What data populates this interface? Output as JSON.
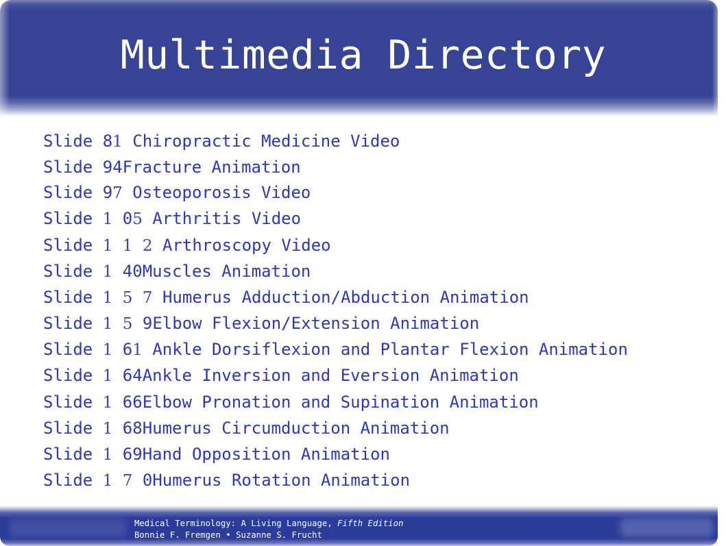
{
  "header": {
    "title": "Multimedia Directory"
  },
  "colors": {
    "header_bg": "#374495",
    "list_text": "#2e35c0",
    "footer_bg": "#2c3c9a"
  },
  "entries": [
    {
      "prefix": "Slide ",
      "parts": [
        {
          "t": "8",
          "s": false
        },
        {
          "t": "1",
          "s": true
        },
        {
          "t": " ",
          "s": false
        }
      ],
      "label": "Chiropractic Medicine Video"
    },
    {
      "prefix": "Slide ",
      "parts": [
        {
          "t": "94",
          "s": false
        }
      ],
      "label": "Fracture Animation"
    },
    {
      "prefix": "Slide ",
      "parts": [
        {
          "t": "9",
          "s": false
        },
        {
          "t": "7",
          "s": true
        },
        {
          "t": " ",
          "s": false
        }
      ],
      "label": "Osteoporosis Video"
    },
    {
      "prefix": "Slide ",
      "parts": [
        {
          "t": "1",
          "s": true
        },
        {
          "t": " 0",
          "s": false
        },
        {
          "t": "5",
          "s": true
        },
        {
          "t": " ",
          "s": false
        }
      ],
      "label": "Arthritis Video"
    },
    {
      "prefix": "Slide ",
      "parts": [
        {
          "t": "1",
          "s": true
        },
        {
          "t": " ",
          "s": false
        },
        {
          "t": "1",
          "s": true
        },
        {
          "t": " ",
          "s": false
        },
        {
          "t": "2",
          "s": true
        },
        {
          "t": " ",
          "s": false
        }
      ],
      "label": "Arthroscopy Video"
    },
    {
      "prefix": "Slide ",
      "parts": [
        {
          "t": "1",
          "s": true
        },
        {
          "t": " 40",
          "s": false
        }
      ],
      "label": "Muscles Animation"
    },
    {
      "prefix": "Slide ",
      "parts": [
        {
          "t": "1",
          "s": true
        },
        {
          "t": " ",
          "s": false
        },
        {
          "t": "5",
          "s": true
        },
        {
          "t": " ",
          "s": false
        },
        {
          "t": "7",
          "s": true
        },
        {
          "t": " ",
          "s": false
        }
      ],
      "label": "Humerus Adduction/Abduction Animation"
    },
    {
      "prefix": "Slide ",
      "parts": [
        {
          "t": "1",
          "s": true
        },
        {
          "t": " ",
          "s": false
        },
        {
          "t": "5",
          "s": true
        },
        {
          "t": " 9",
          "s": false
        }
      ],
      "label": "Elbow Flexion/Extension Animation"
    },
    {
      "prefix": "Slide ",
      "parts": [
        {
          "t": "1",
          "s": true
        },
        {
          "t": " 6",
          "s": false
        },
        {
          "t": "1",
          "s": true
        },
        {
          "t": " ",
          "s": false
        }
      ],
      "label": "Ankle Dorsiflexion and Plantar Flexion Animation"
    },
    {
      "prefix": "Slide ",
      "parts": [
        {
          "t": "1",
          "s": true
        },
        {
          "t": " 64",
          "s": false
        }
      ],
      "label": "Ankle Inversion and Eversion Animation"
    },
    {
      "prefix": "Slide ",
      "parts": [
        {
          "t": "1",
          "s": true
        },
        {
          "t": " 66",
          "s": false
        }
      ],
      "label": "Elbow Pronation and Supination Animation"
    },
    {
      "prefix": "Slide ",
      "parts": [
        {
          "t": "1",
          "s": true
        },
        {
          "t": " 68",
          "s": false
        }
      ],
      "label": "Humerus Circumduction Animation"
    },
    {
      "prefix": "Slide ",
      "parts": [
        {
          "t": "1",
          "s": true
        },
        {
          "t": " 69",
          "s": false
        }
      ],
      "label": "Hand Opposition Animation"
    },
    {
      "prefix": "Slide ",
      "parts": [
        {
          "t": "1",
          "s": true
        },
        {
          "t": " ",
          "s": false
        },
        {
          "t": "7",
          "s": true
        },
        {
          "t": " 0",
          "s": false
        }
      ],
      "label": "Humerus Rotation Animation"
    }
  ],
  "footer": {
    "book_title": "Medical Terminology: A Living Language, ",
    "edition": "Fifth Edition",
    "authors": "Bonnie F. Fremgen • Suzanne S. Frucht"
  }
}
